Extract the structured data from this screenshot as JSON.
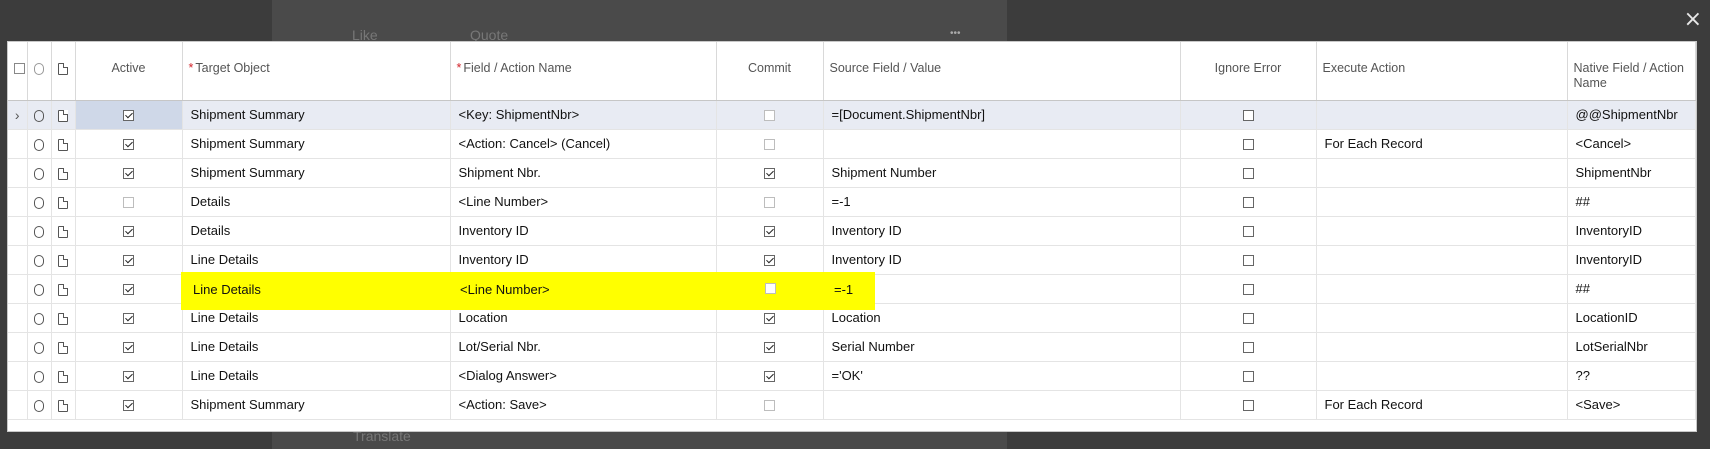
{
  "background": {
    "like_label": "Like",
    "quote_label": "Quote",
    "more_label": "•••",
    "translate_label": "Translate"
  },
  "window": {
    "close_label": "×"
  },
  "grid": {
    "columns": [
      {
        "key": "active",
        "label": "Active",
        "required": false
      },
      {
        "key": "target",
        "label": "Target Object",
        "required": true
      },
      {
        "key": "field",
        "label": "Field / Action Name",
        "required": true
      },
      {
        "key": "commit",
        "label": "Commit",
        "required": false
      },
      {
        "key": "source",
        "label": "Source Field / Value",
        "required": false
      },
      {
        "key": "ignore",
        "label": "Ignore Error",
        "required": false
      },
      {
        "key": "execute",
        "label": "Execute Action",
        "required": false
      },
      {
        "key": "native",
        "label": "Native Field / Action Name",
        "required": false
      }
    ],
    "rows": [
      {
        "active": true,
        "target": "Shipment Summary",
        "field": "<Key: ShipmentNbr>",
        "commit": false,
        "source": "=[Document.ShipmentNbr]",
        "ignore": false,
        "execute": "",
        "native": "@@ShipmentNbr"
      },
      {
        "active": true,
        "target": "Shipment Summary",
        "field": "<Action: Cancel> (Cancel)",
        "commit": false,
        "source": "",
        "ignore": false,
        "execute": "For Each Record",
        "native": "<Cancel>"
      },
      {
        "active": true,
        "target": "Shipment Summary",
        "field": "Shipment Nbr.",
        "commit": true,
        "source": "Shipment Number",
        "ignore": false,
        "execute": "",
        "native": "ShipmentNbr"
      },
      {
        "active": false,
        "target": "Details",
        "field": "<Line Number>",
        "commit": false,
        "source": "=-1",
        "ignore": false,
        "execute": "",
        "native": "##"
      },
      {
        "active": true,
        "target": "Details",
        "field": "Inventory ID",
        "commit": true,
        "source": "Inventory ID",
        "ignore": false,
        "execute": "",
        "native": "InventoryID"
      },
      {
        "active": true,
        "target": "Line Details",
        "field": "Inventory ID",
        "commit": true,
        "source": "Inventory ID",
        "ignore": false,
        "execute": "",
        "native": "InventoryID"
      },
      {
        "active": true,
        "target": "Line Details",
        "field": "<Line Number>",
        "commit": false,
        "source": "=-1",
        "ignore": false,
        "execute": "",
        "native": "##"
      },
      {
        "active": true,
        "target": "Line Details",
        "field": "Location",
        "commit": true,
        "source": "Location",
        "ignore": false,
        "execute": "",
        "native": "LocationID"
      },
      {
        "active": true,
        "target": "Line Details",
        "field": "Lot/Serial Nbr.",
        "commit": true,
        "source": "Serial Number",
        "ignore": false,
        "execute": "",
        "native": "LotSerialNbr"
      },
      {
        "active": true,
        "target": "Line Details",
        "field": "<Dialog Answer>",
        "commit": true,
        "source": "='OK'",
        "ignore": false,
        "execute": "",
        "native": "??"
      },
      {
        "active": true,
        "target": "Shipment Summary",
        "field": "<Action: Save>",
        "commit": false,
        "source": "",
        "ignore": false,
        "execute": "For Each Record",
        "native": "<Save>"
      }
    ],
    "highlighted_row": {
      "target": "Line Details",
      "field": "<Line Number>",
      "source": "=-1"
    }
  },
  "colors": {
    "highlight": "#ffff00",
    "selected_row": "#e8ebf3",
    "required": "#d2232a"
  }
}
